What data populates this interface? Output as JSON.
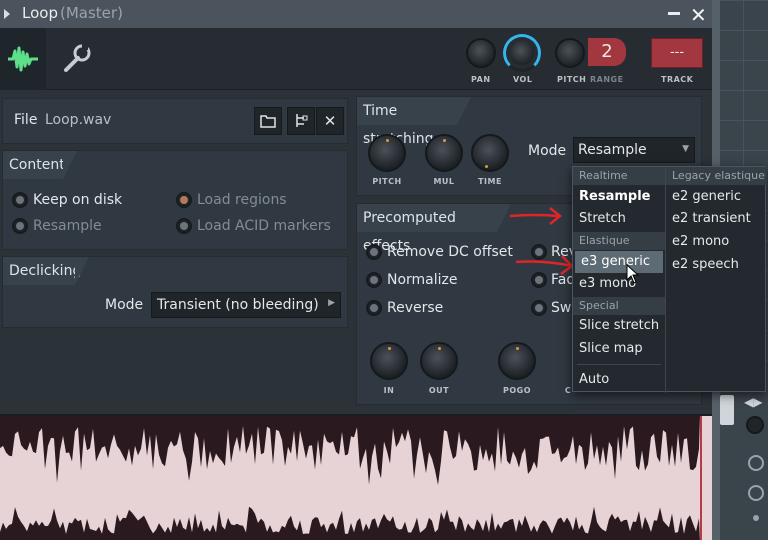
{
  "title": {
    "name": "Loop",
    "context": "(Master)"
  },
  "toolbar": {
    "pan_label": "PAN",
    "vol_label": "VOL",
    "pitch_label": "PITCH",
    "range_label": "RANGE",
    "pitch_value": "2",
    "track_value": "---",
    "track_label": "TRACK"
  },
  "file": {
    "label": "File",
    "name": "Loop.wav"
  },
  "content": {
    "header": "Content",
    "options": [
      {
        "label": "Keep on disk"
      },
      {
        "label": "Load regions"
      },
      {
        "label": "Resample"
      },
      {
        "label": "Load ACID markers"
      }
    ]
  },
  "declicking": {
    "header": "Declicking",
    "mode_label": "Mode",
    "mode_value": "Transient (no bleeding)"
  },
  "time_stretching": {
    "header": "Time stretching",
    "knobs": [
      "PITCH",
      "MUL",
      "TIME"
    ],
    "mode_label": "Mode",
    "mode_value": "Resample"
  },
  "precomputed": {
    "header": "Precomputed effects",
    "options": [
      "Remove DC offset",
      "Normalize",
      "Reverse"
    ],
    "right_partial": [
      "Rev",
      "Fad",
      "Swa"
    ],
    "knobs": [
      "IN",
      "OUT",
      "POGO",
      "C"
    ]
  },
  "menu": {
    "col1": {
      "realtime_header": "Realtime",
      "realtime": [
        "Resample",
        "Stretch"
      ],
      "elastique_header": "Elastique",
      "elastique": [
        "e3 generic",
        "e3 mono"
      ],
      "special_header": "Special",
      "special": [
        "Slice stretch",
        "Slice map"
      ],
      "auto": "Auto"
    },
    "col2": {
      "header": "Legacy elastique",
      "items": [
        "e2 generic",
        "e2 transient",
        "e2 mono",
        "e2 speech"
      ]
    }
  },
  "colors": {
    "accent_red": "#a3373f",
    "vol_ring": "#35b6e8",
    "wave_color": "#2a1a1f"
  }
}
